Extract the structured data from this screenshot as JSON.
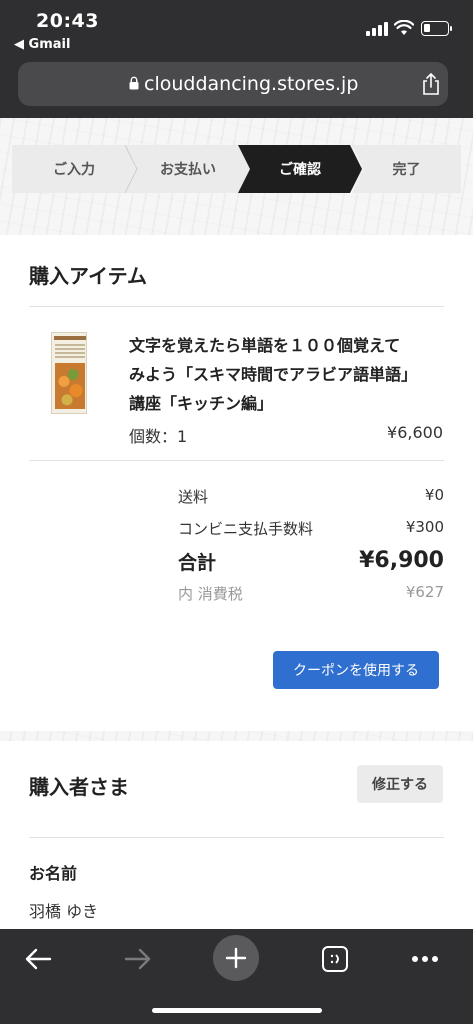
{
  "status_bar": {
    "time": "20:43",
    "back_app": "◀ Gmail"
  },
  "browser": {
    "url": "clouddancing.stores.jp"
  },
  "steps": [
    {
      "label": "ご入力"
    },
    {
      "label": "お支払い"
    },
    {
      "label": "ご確認",
      "active": true
    },
    {
      "label": "完了"
    }
  ],
  "purchase": {
    "title": "購入アイテム",
    "item": {
      "name": "文字を覚えたら単語を１００個覚えてみよう「スキマ時間でアラビア語単語」講座「キッチン編」",
      "quantity": "個数：1",
      "price": "¥6,600"
    },
    "summary": {
      "shipping_label": "送料",
      "shipping_value": "¥0",
      "fee_label": "コンビニ支払手数料",
      "fee_value": "¥300",
      "total_label": "合計",
      "total_value": "¥6,900",
      "tax_label": "内 消費税",
      "tax_value": "¥627"
    },
    "coupon_button": "クーポンを使用する"
  },
  "buyer": {
    "title": "購入者さま",
    "edit_button": "修正する",
    "name_label": "お名前",
    "name_value": "羽橋 ゆき"
  },
  "colors": {
    "accent": "#2f6fd0",
    "chrome": "#2f2f31",
    "active_step": "#1e1e1e"
  }
}
